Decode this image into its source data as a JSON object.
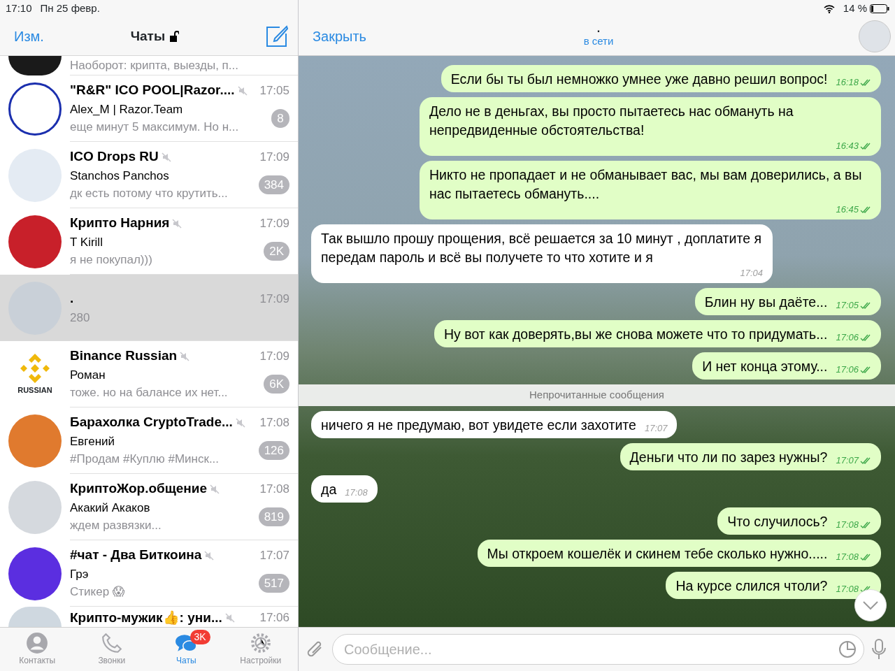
{
  "status_bar": {
    "time": "17:10",
    "date": "Пн 25 февр.",
    "battery": "14 %"
  },
  "chat_list_header": {
    "edit": "Изм.",
    "title": "Чаты"
  },
  "chats": [
    {
      "kind": "partial_top",
      "preview": "Наоборот: крипта, выезды, п..."
    },
    {
      "kind": "full",
      "name": "\"R&R\" ICO POOL|Razor....",
      "muted": true,
      "time": "17:05",
      "sender": "Alex_M | Razor.Team",
      "preview": "еще минут 5 максимум. Но н...",
      "unread": "8",
      "selected": false
    },
    {
      "kind": "full",
      "name": "ICO Drops RU",
      "muted": true,
      "time": "17:09",
      "sender": "Stanchos Panchos",
      "preview": "дк есть потому что крутить...",
      "unread": "384",
      "selected": false
    },
    {
      "kind": "full",
      "name": "Крипто Нарния",
      "muted": true,
      "time": "17:09",
      "sender": "T Kirill",
      "preview": "я не покупал)))",
      "unread": "2K",
      "selected": false
    },
    {
      "kind": "full",
      "name": ".",
      "muted": false,
      "time": "17:09",
      "preview": "280",
      "selected": true
    },
    {
      "kind": "full",
      "name": "Binance Russian",
      "muted": true,
      "time": "17:09",
      "sender": "Роман",
      "preview": "тоже. но на балансе их нет...",
      "unread": "6K",
      "selected": false,
      "avatar_label": "RUSSIAN"
    },
    {
      "kind": "full",
      "name": "Барахолка CryptoTrade...",
      "muted": true,
      "time": "17:08",
      "sender": "Евгений",
      "preview": "#Продам #Куплю  #Минск...",
      "unread": "126",
      "selected": false
    },
    {
      "kind": "full",
      "name": "КриптоЖор.общение",
      "muted": true,
      "time": "17:08",
      "sender": "Акакий Акаков",
      "preview": "ждем развязки...",
      "unread": "819",
      "selected": false
    },
    {
      "kind": "full",
      "name": "#чат - Два Биткоина",
      "muted": true,
      "time": "17:07",
      "sender": "Грэ",
      "preview": "Стикер 😱",
      "unread": "517",
      "selected": false
    },
    {
      "kind": "partial_bottom",
      "name": "Крипто-мужик👍: уни...",
      "muted": true,
      "time": "17:06"
    }
  ],
  "tab_bar": [
    {
      "label": "Контакты",
      "selected": false
    },
    {
      "label": "Звонки",
      "selected": false
    },
    {
      "label": "Чаты",
      "selected": true,
      "badge": "3K"
    },
    {
      "label": "Настройки",
      "selected": false
    }
  ],
  "chat_header": {
    "close": "Закрыть",
    "title": ".",
    "status": "в сети"
  },
  "messages": [
    {
      "kind": "out",
      "text": "Если бы ты был немножко умнее уже давно решил вопрос!",
      "time": "16:18"
    },
    {
      "kind": "out",
      "text": "Дело не в деньгах, вы просто пытаетесь нас обмануть на непредвиденные обстоятельства!",
      "time": "16:43"
    },
    {
      "kind": "out",
      "text": "Никто не пропадает и не обманывает вас, мы вам доверились, а вы нас пытаетесь обмануть....",
      "time": "16:45"
    },
    {
      "kind": "in",
      "text": "Так вышло прошу прощения, всё решается за 10 минут , доплатите я передам пароль и всё вы получете то что хотите и я",
      "time": "17:04"
    },
    {
      "kind": "out",
      "text": "Блин ну вы даёте...",
      "time": "17:05"
    },
    {
      "kind": "out",
      "text": "Ну вот как доверять,вы же снова можете что то придумать...",
      "time": "17:06"
    },
    {
      "kind": "out",
      "text": "И нет конца этому...",
      "time": "17:06"
    },
    {
      "kind": "divider",
      "text": "Непрочитанные сообщения"
    },
    {
      "kind": "in",
      "text": "ничего я не предумаю, вот увидете если захотите",
      "time": "17:07"
    },
    {
      "kind": "out",
      "text": "Деньги что ли по зарез нужны?",
      "time": "17:07"
    },
    {
      "kind": "in",
      "text": "да",
      "time": "17:08"
    },
    {
      "kind": "out",
      "text": "Что случилось?",
      "time": "17:08"
    },
    {
      "kind": "out",
      "text": "Мы откроем кошелёк и скинем тебе сколько нужно.....",
      "time": "17:08"
    },
    {
      "kind": "out",
      "text": "На курсе слился чтоли?",
      "time": "17:08"
    }
  ],
  "composer": {
    "placeholder": "Сообщение..."
  }
}
